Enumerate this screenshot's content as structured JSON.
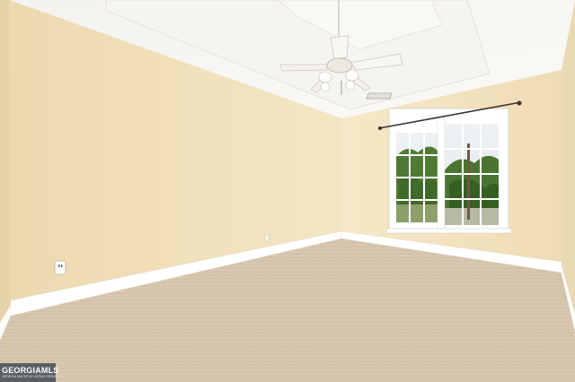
{
  "photo": {
    "scene": "Empty bedroom with carpet, window and ceiling fan",
    "colors": {
      "left_wall": "#f0dfb8",
      "right_wall": "#f3e3bd",
      "ceiling": "#f7f6f2",
      "carpet": "#d9c7b0",
      "trim": "#ffffff",
      "foliage": "#4f7a34"
    }
  },
  "watermark": {
    "brand": "GEORGIAMLS",
    "subtitle": "GEORGIA MULTIPLE LISTING SERVICE"
  }
}
